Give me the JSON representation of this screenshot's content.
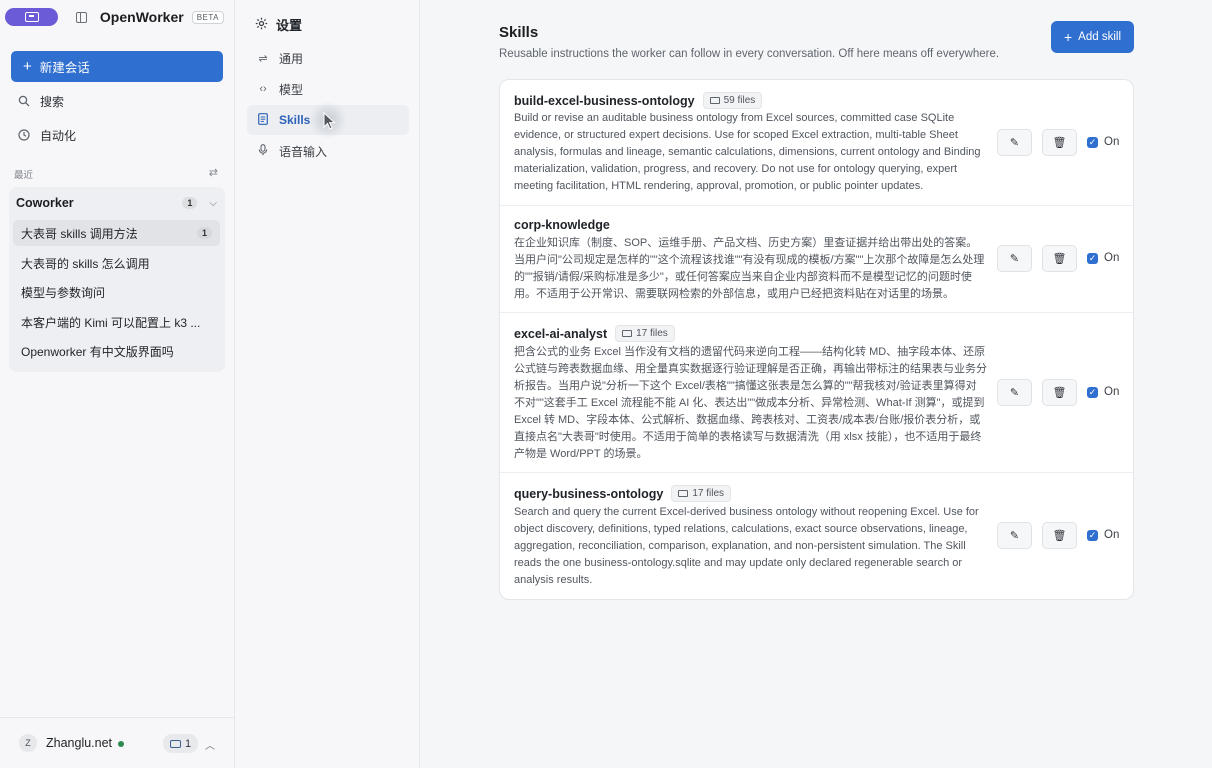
{
  "app": {
    "brand": "OpenWorker",
    "beta": "BETA"
  },
  "sidebar": {
    "new_chat": "新建会话",
    "search": "搜索",
    "automation": "自动化",
    "recent_label": "最近",
    "group": {
      "name": "Coworker",
      "count": "1"
    },
    "conversations": [
      {
        "title": "大表哥 skills 调用方法",
        "count": "1"
      },
      {
        "title": "大表哥的 skills 怎么调用"
      },
      {
        "title": "模型与参数询问"
      },
      {
        "title": "本客户端的 Kimi 可以配置上 k3 ..."
      },
      {
        "title": "Openworker 有中文版界面吗"
      }
    ],
    "user": {
      "initial": "Z",
      "name": "Zhanglu.net",
      "inbox_count": "1"
    }
  },
  "settings_nav": {
    "title": "设置",
    "items": [
      {
        "label": "通用",
        "icon": "sliders-icon"
      },
      {
        "label": "模型",
        "icon": "code-icon"
      },
      {
        "label": "Skills",
        "icon": "document-icon",
        "active": true
      },
      {
        "label": "语音输入",
        "icon": "microphone-icon"
      }
    ]
  },
  "main": {
    "title": "Skills",
    "subtitle": "Reusable instructions the worker can follow in every conversation. Off here means off everywhere.",
    "add_button": "Add skill",
    "toggle_label": "On",
    "skills": [
      {
        "name": "build-excel-business-ontology",
        "files": "59 files",
        "description": "Build or revise an auditable business ontology from Excel sources, committed case SQLite evidence, or structured expert decisions. Use for scoped Excel extraction, multi-table Sheet analysis, formulas and lineage, semantic calculations, dimensions, current ontology and Binding materialization, validation, progress, and recovery. Do not use for ontology querying, expert meeting facilitation, HTML rendering, approval, promotion, or public pointer updates.",
        "enabled": true
      },
      {
        "name": "corp-knowledge",
        "files": "",
        "description": "在企业知识库（制度、SOP、运维手册、产品文档、历史方案）里查证据并给出带出处的答案。当用户问\"公司规定是怎样的\"\"这个流程该找谁\"\"有没有现成的模板/方案\"\"上次那个故障是怎么处理的\"\"报销/请假/采购标准是多少\"，或任何答案应当来自企业内部资料而不是模型记忆的问题时使用。不适用于公开常识、需要联网检索的外部信息，或用户已经把资料贴在对话里的场景。",
        "enabled": true
      },
      {
        "name": "excel-ai-analyst",
        "files": "17 files",
        "description": "把含公式的业务 Excel 当作没有文档的遗留代码来逆向工程——结构化转 MD、抽字段本体、还原公式链与跨表数据血缘、用全量真实数据逐行验证理解是否正确，再输出带标注的结果表与业务分析报告。当用户说\"分析一下这个 Excel/表格\"\"搞懂这张表是怎么算的\"\"帮我核对/验证表里算得对不对\"\"这套手工 Excel 流程能不能 AI 化、表达出\"\"做成本分析、异常检测、What-If 测算\"，或提到 Excel 转 MD、字段本体、公式解析、数据血缘、跨表核对、工资表/成本表/台账/报价表分析，或直接点名\"大表哥\"时使用。不适用于简单的表格读写与数据清洗（用 xlsx 技能），也不适用于最终产物是 Word/PPT 的场景。",
        "enabled": true
      },
      {
        "name": "query-business-ontology",
        "files": "17 files",
        "description": "Search and query the current Excel-derived business ontology without reopening Excel. Use for object discovery, definitions, typed relations, calculations, exact source observations, lineage, aggregation, reconciliation, comparison, explanation, and non-persistent simulation. The Skill reads the one business-ontology.sqlite and may update only declared regenerable search or analysis results.",
        "enabled": true
      }
    ]
  },
  "colors": {
    "accent": "#2f6fd0",
    "brand_pill": "#6b5bd6",
    "online": "#2f8a52"
  }
}
